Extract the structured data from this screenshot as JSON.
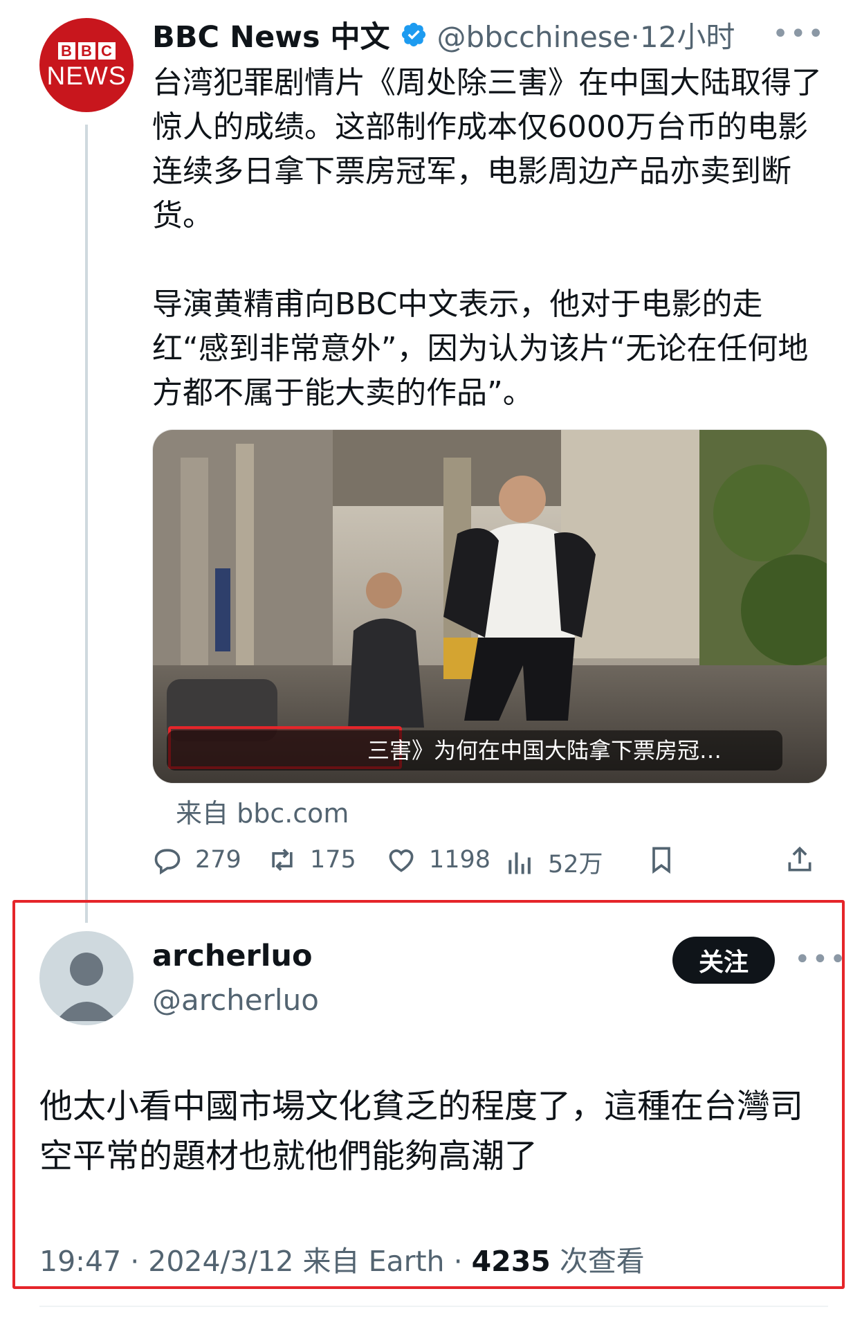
{
  "original_tweet": {
    "avatar_logo": "BBC NEWS",
    "author_name": "BBC News 中文",
    "verified_icon": "verified-badge-icon",
    "handle": "@bbcchinese",
    "time_ago": "12小时",
    "more_icon": "more-horizontal-icon",
    "text_paragraph_1": "台湾犯罪剧情片《周处除三害》在中国大陆取得了惊人的成绩。这部制作成本仅6000万台币的电影连续多日拿下票房冠军，电影周边产品亦卖到断货。",
    "text_paragraph_2": "导演黄精甫向BBC中文表示，他对于电影的走红“感到非常意外”，因为认为该片“无论在任何地方都不属于能大卖的作品”。",
    "media_caption": "三害》为何在中国大陆拿下票房冠…",
    "source": "来自 bbc.com",
    "actions": {
      "replies": "279",
      "retweets": "175",
      "likes": "1198",
      "views": "52万"
    },
    "icons": [
      "reply-icon",
      "retweet-icon",
      "like-icon",
      "views-icon",
      "bookmark-icon",
      "share-icon"
    ]
  },
  "reply_tweet": {
    "author_name": "archerluo",
    "handle": "@archerluo",
    "follow_label": "关注",
    "more_icon": "more-horizontal-icon",
    "text": "他太小看中國市場文化貧乏的程度了，這種在台灣司空平常的題材也就他們能夠高潮了",
    "time": "19:47",
    "date": "2024/3/12",
    "source": "来自 Earth",
    "view_count": "4235",
    "view_label": "次查看"
  },
  "colors": {
    "text_primary": "#0f1419",
    "text_secondary": "#536471",
    "verified_blue": "#1d9bf0",
    "bbc_red": "#c8161d",
    "highlight_red": "#e5252a"
  }
}
